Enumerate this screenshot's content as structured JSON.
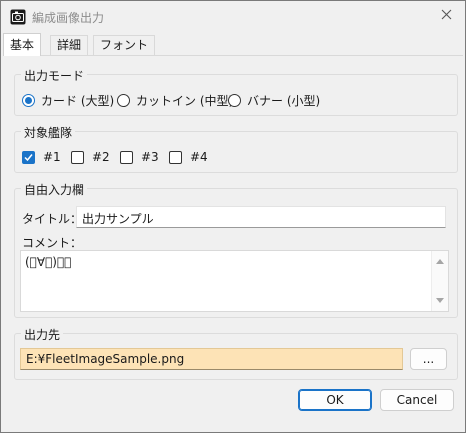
{
  "window": {
    "title": "編成画像出力",
    "app_icon": "camera-icon",
    "close_icon": "close-icon"
  },
  "tabs": [
    {
      "label": "基本",
      "active": true
    },
    {
      "label": "詳細",
      "active": false
    },
    {
      "label": "フォント",
      "active": false
    }
  ],
  "output_mode": {
    "label": "出力モード",
    "options": [
      {
        "label": "カード (大型)",
        "checked": true
      },
      {
        "label": "カットイン (中型)",
        "checked": false
      },
      {
        "label": "バナー (小型)",
        "checked": false
      }
    ]
  },
  "fleets": {
    "label": "対象艦隊",
    "items": [
      {
        "label": "#1",
        "checked": true
      },
      {
        "label": "#2",
        "checked": false
      },
      {
        "label": "#3",
        "checked": false
      },
      {
        "label": "#4",
        "checked": false
      }
    ]
  },
  "free_input": {
    "label": "自由入力欄",
    "title_label": "タイトル：",
    "title_value": "出力サンプル",
    "comment_label": "コメント：",
    "comment_value": "(ﾟ∀ﾟ)！？"
  },
  "output": {
    "label": "出力先",
    "path": "E:¥FleetImageSample.png",
    "browse_label": "..."
  },
  "footer": {
    "ok_label": "OK",
    "cancel_label": "Cancel"
  },
  "colors": {
    "accent": "#1a73c8",
    "path_background": "#fde3b6"
  }
}
